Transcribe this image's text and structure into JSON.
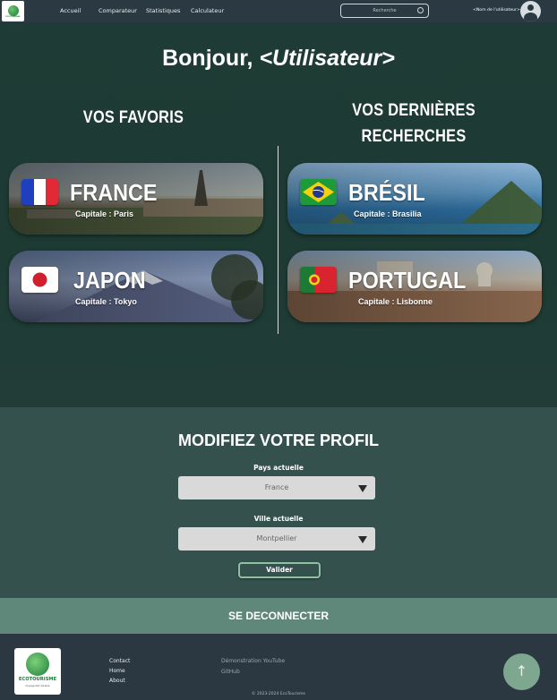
{
  "nav": {
    "logo_text": "ECOTOURISME",
    "links": [
      "Accueil",
      "Comparateur",
      "Statistiques",
      "Calculateur"
    ],
    "search_placeholder": "Recherche",
    "username": "<Nom de l'utilisateur>"
  },
  "hero": {
    "greeting": "Bonjour, ",
    "greeting_user": "<Utilisateur>",
    "favorites_title": "VOS FAVORIS",
    "recent_title_line1": "VOS DERNIÈRES",
    "recent_title_line2": "RECHERCHES",
    "favorites": [
      {
        "name": "FRANCE",
        "capital": "Capitale : Paris"
      },
      {
        "name": "JAPON",
        "capital": "Capitale : Tokyo"
      }
    ],
    "recent": [
      {
        "name": "BRÉSIL",
        "capital": "Capitale : Brasilia"
      },
      {
        "name": "PORTUGAL",
        "capital": "Capitale : Lisbonne"
      }
    ]
  },
  "profile": {
    "title": "MODIFIEZ VOTRE PROFIL",
    "country_label": "Pays actuelle",
    "country_value": "France",
    "city_label": "Ville actuelle",
    "city_value": "Montpellier",
    "submit_label": "Valider"
  },
  "logout_label": "SE DECONNECTER",
  "footer": {
    "brand": "ECOTOURISME",
    "tagline": "Voyage fait durable",
    "links_col1": [
      "Contact",
      "Home",
      "About"
    ],
    "links_col2": [
      "Démonstration YouTube",
      "GitHub"
    ],
    "copyright": "© 2023-2024 EcoTourisme",
    "back_to_top": "↑"
  },
  "colors": {
    "topbar": "#2a3942",
    "hero_bg": "#1f3b35",
    "profile_bg": "#35514e",
    "logout_bg": "#5f887a",
    "footer_bg": "#2b3842",
    "accent": "#7ea78f"
  }
}
